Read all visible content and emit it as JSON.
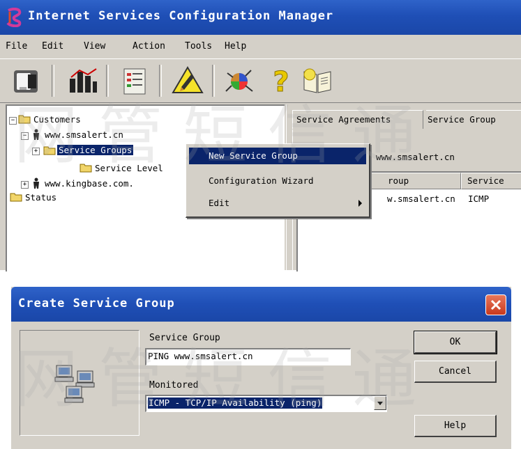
{
  "window": {
    "title": "Internet Services Configuration Manager",
    "menu": [
      "File",
      "Edit",
      "View",
      "Action",
      "Tools",
      "Help"
    ],
    "toolbar_icons": [
      "database-icon",
      "chart-icon",
      "form-icon",
      "alert-icon",
      "network-icon",
      "help-icon",
      "book-icon"
    ]
  },
  "tree": {
    "root": "Customers",
    "items": [
      {
        "label": "www.smsalert.cn",
        "type": "customer",
        "expanded": true
      },
      {
        "label": "Service Groups",
        "type": "folder",
        "selected": true
      },
      {
        "label": "Service Level",
        "type": "folder"
      },
      {
        "label": "www.kingbase.com.",
        "type": "customer"
      },
      {
        "label": "Status",
        "type": "folder"
      }
    ]
  },
  "right_pane": {
    "tabs": [
      "Service Agreements",
      "Service Group"
    ],
    "group_title": "www.smsalert.cn",
    "columns": [
      "roup",
      "Service"
    ],
    "rows": [
      [
        "w.smsalert.cn",
        "ICMP"
      ]
    ]
  },
  "context_menu": {
    "items": [
      {
        "label": "New Service Group",
        "highlighted": true
      },
      {
        "label": "Configuration Wizard"
      },
      {
        "label": "Edit",
        "submenu": true
      }
    ]
  },
  "dialog": {
    "title": "Create Service Group",
    "service_group_label": "Service Group",
    "service_group_value": "PING www.smsalert.cn",
    "monitored_label": "Monitored",
    "monitored_value": "ICMP - TCP/IP Availability (ping)",
    "ok_label": "OK",
    "cancel_label": "Cancel",
    "help_label": "Help"
  },
  "colors": {
    "titlebar": "#1f4fb6",
    "face": "#d4d0c8",
    "selection": "#0a246a",
    "close_button": "#d9512f"
  }
}
